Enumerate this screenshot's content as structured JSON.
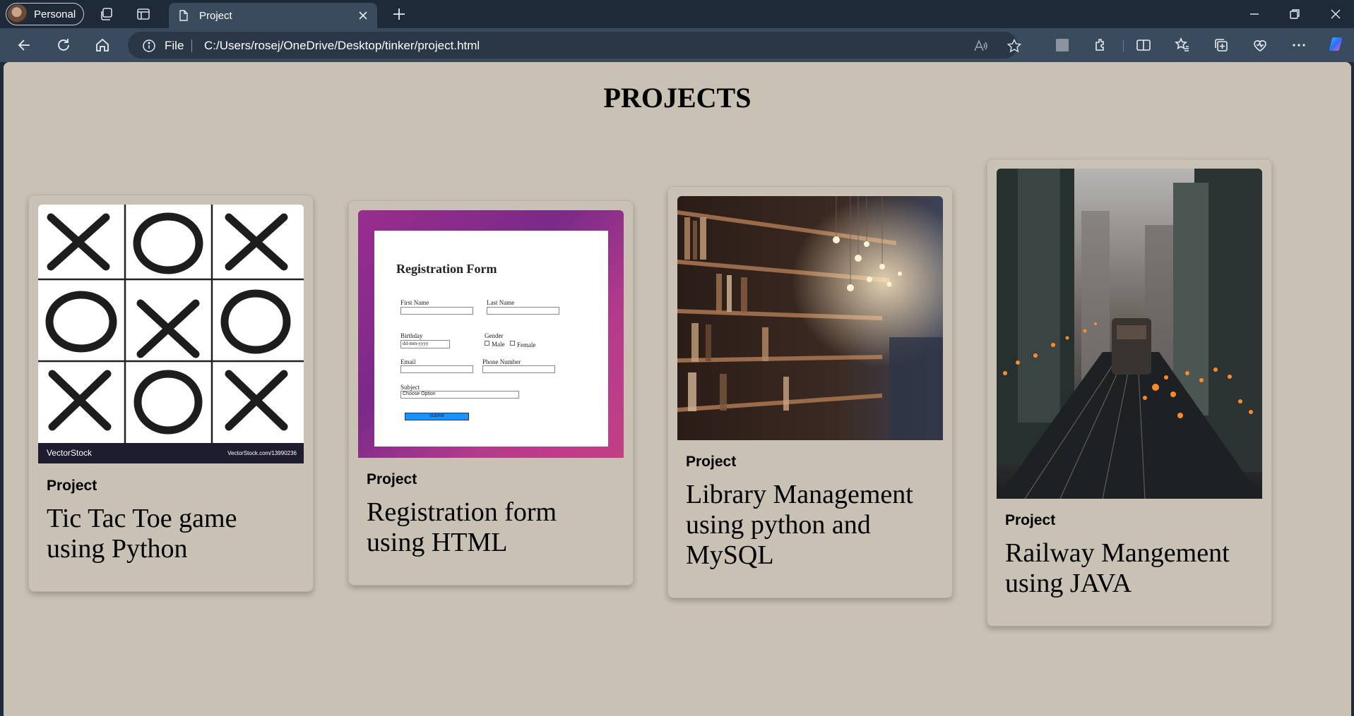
{
  "browser": {
    "profile_label": "Personal",
    "tab_title": "Project",
    "address": {
      "scheme_label": "File",
      "url": "C:/Users/rosej/OneDrive/Desktop/tinker/project.html"
    }
  },
  "page": {
    "heading": "PROJECTS",
    "cards": [
      {
        "label": "Project",
        "title": "Tic Tac Toe game using Python",
        "image": "tic-tac-toe-grid",
        "image_caption_left": "VectorStock",
        "image_caption_right": "VectorStock.com/13990236"
      },
      {
        "label": "Project",
        "title": "Registration form using HTML",
        "image": "registration-form-screenshot",
        "form": {
          "heading": "Registration Form",
          "first_name": "First Name",
          "last_name": "Last Name",
          "birthday": "Birthday",
          "birthday_placeholder": "dd-mm-yyyy",
          "gender": "Gender",
          "male": "Male",
          "female": "Female",
          "email": "Email",
          "phone": "Phone Number",
          "subject": "Subject",
          "subject_option": "Choose Option",
          "submit": "submit"
        }
      },
      {
        "label": "Project",
        "title": "Library Management using python and MySQL",
        "image": "library-bookshelves-photo"
      },
      {
        "label": "Project",
        "title": "Railway Mangement using JAVA",
        "image": "city-railway-night-photo"
      }
    ]
  }
}
